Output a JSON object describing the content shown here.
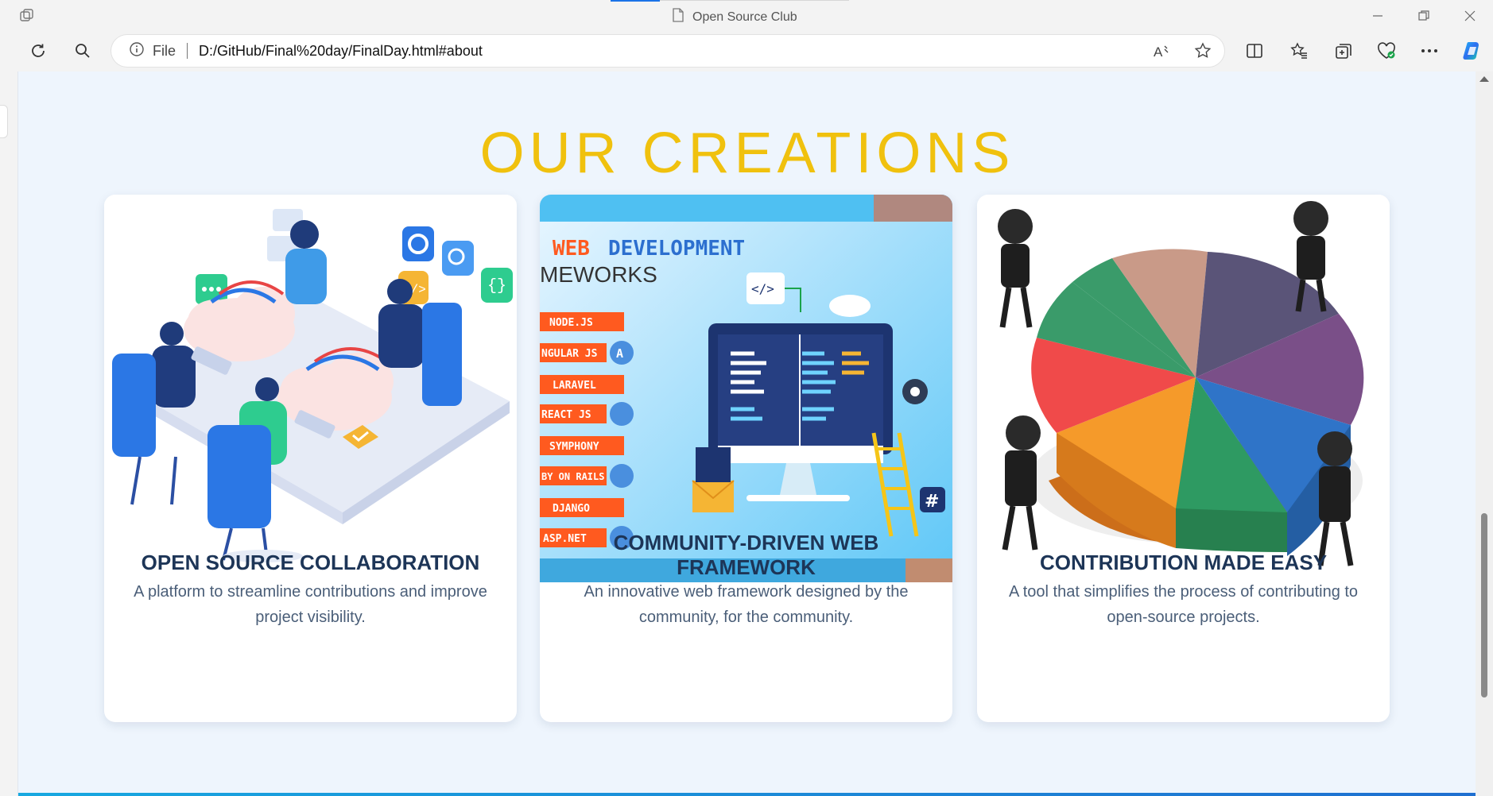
{
  "browser": {
    "tab_title": "Open Source Club",
    "address_prefix": "File",
    "url": "D:/GitHub/Final%20day/FinalDay.html#about",
    "icons": [
      "tab-actions-icon",
      "refresh-icon",
      "search-icon",
      "site-info-icon",
      "read-aloud-icon",
      "favorite-star-icon",
      "split-screen-icon",
      "favorites-icon",
      "collections-icon",
      "browser-essentials-icon",
      "more-icon",
      "copilot-icon",
      "minimize-icon",
      "restore-icon",
      "close-icon"
    ]
  },
  "page": {
    "section_title": "OUR CREATIONS",
    "cards": [
      {
        "title": "OPEN SOURCE COLLABORATION",
        "description": "A platform to streamline contributions and improve project visibility."
      },
      {
        "title": "COMMUNITY-DRIVEN WEB FRAMEWORK",
        "description": "An innovative web framework designed by the community, for the community.",
        "image": {
          "heading_part1": "WEB",
          "heading_part2": "DEVELOPMENT",
          "subheading": "MEWORKS",
          "frameworks": [
            "NODE.JS",
            "NGULAR JS",
            "LARAVEL",
            "REACT JS",
            "SYMPHONY",
            "BY ON RAILS",
            "DJANGO",
            "ASP.NET"
          ]
        }
      },
      {
        "title": "CONTRIBUTION MADE EASY",
        "description": "A tool that simplifies the process of contributing to open-source projects."
      }
    ]
  },
  "colors": {
    "title_yellow": "#f0c10e",
    "card_title": "#1d3557",
    "card_text": "#4a5e78",
    "page_bg": "#eef5fd"
  }
}
